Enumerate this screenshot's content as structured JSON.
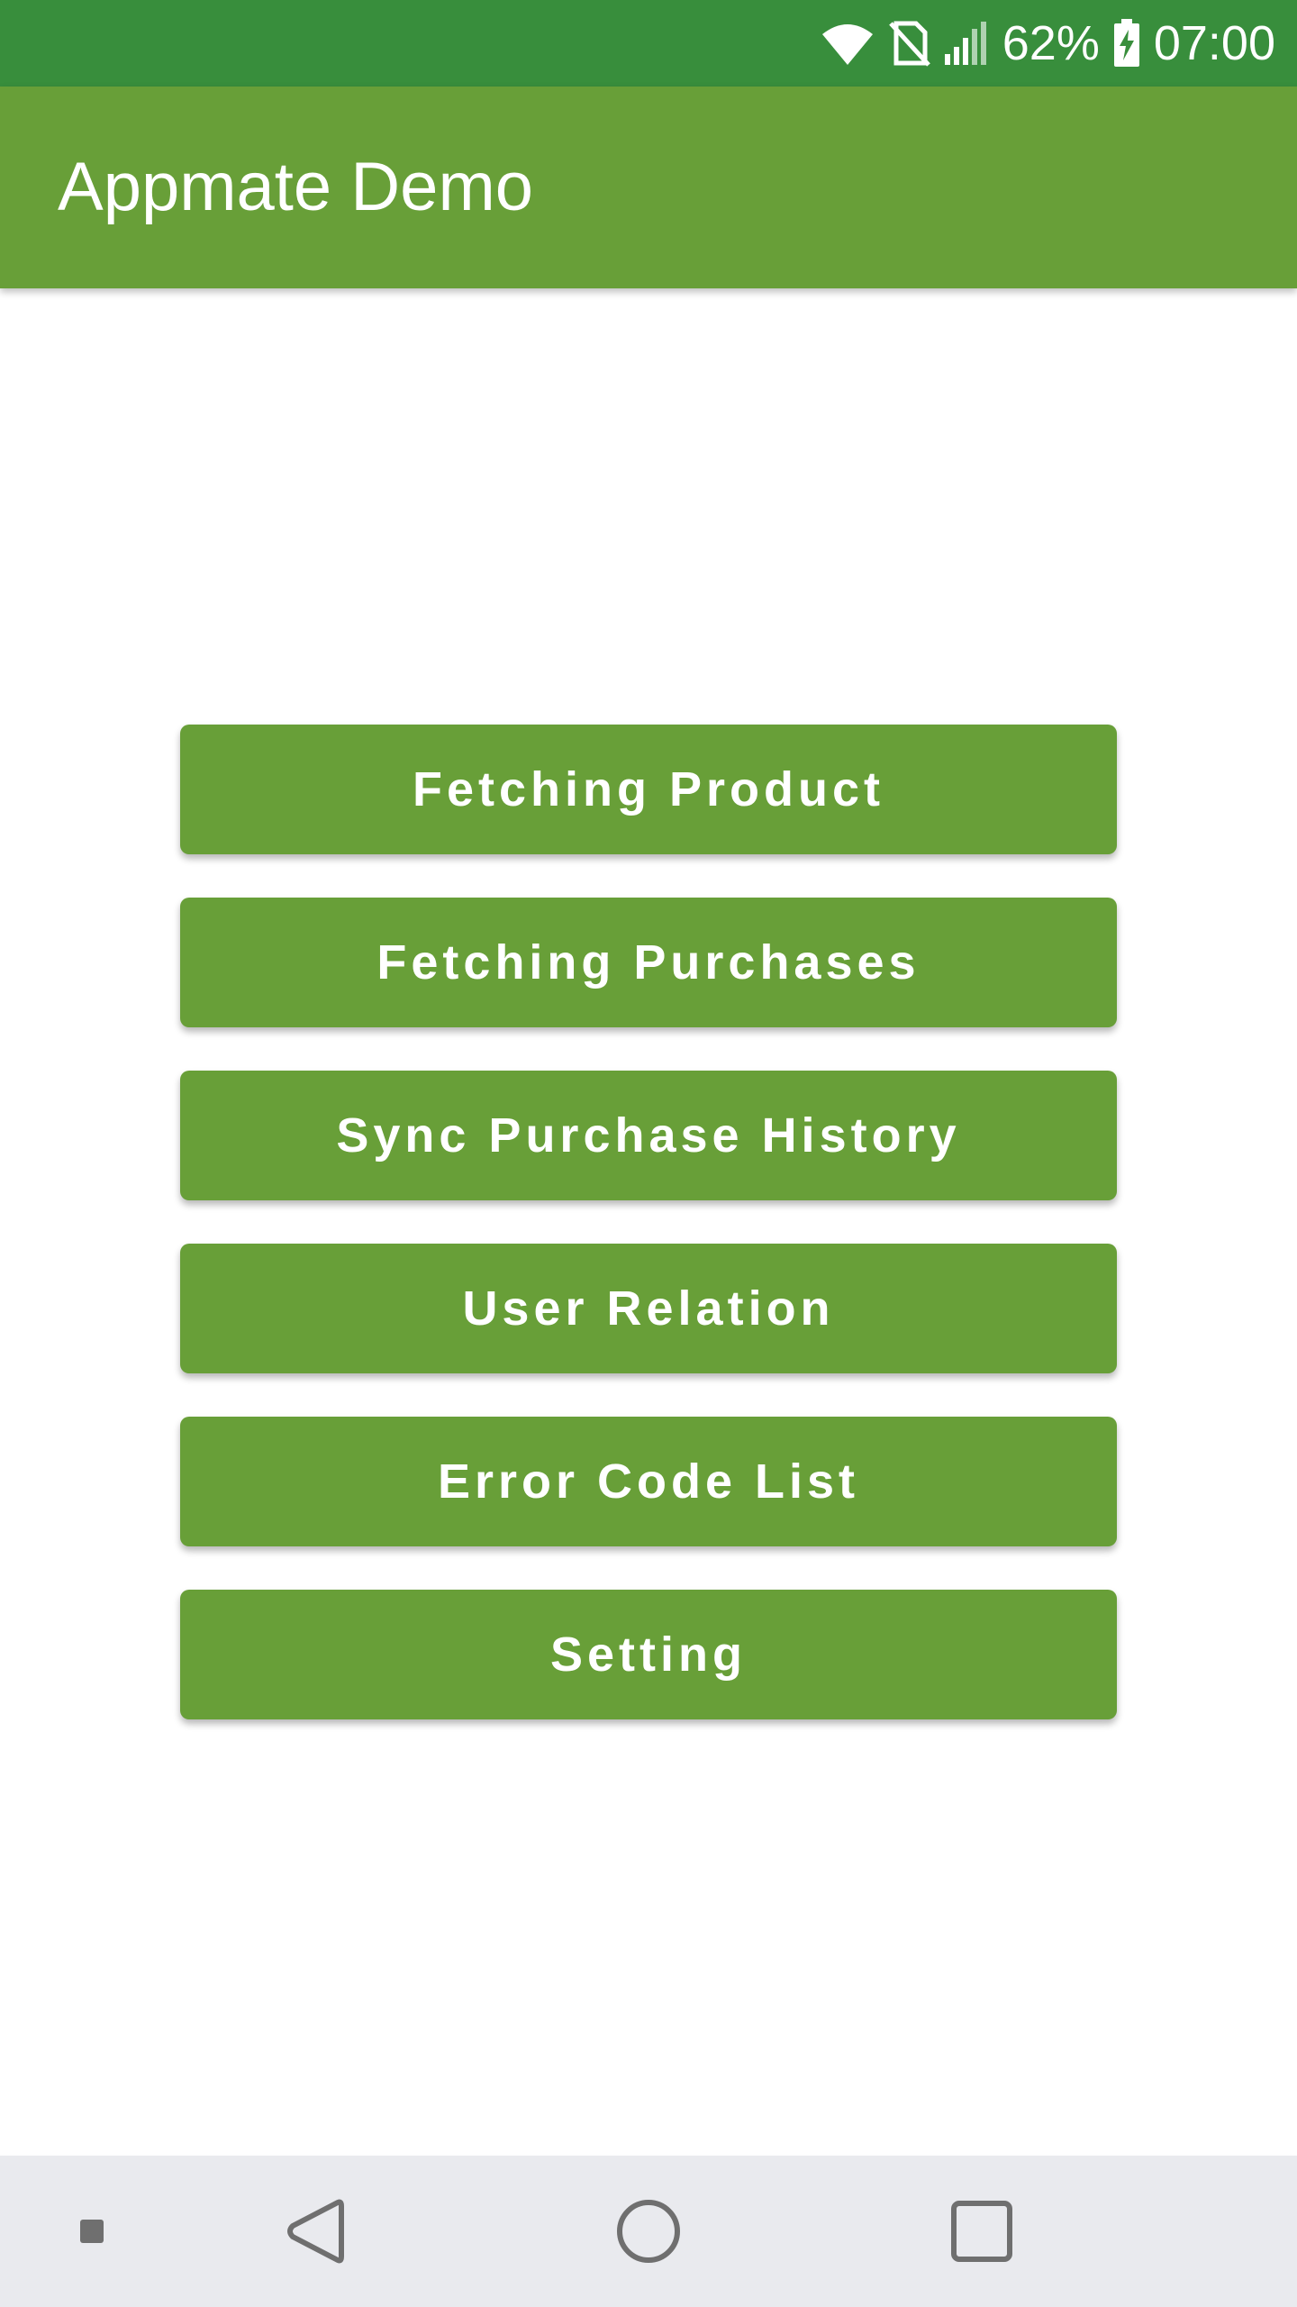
{
  "status_bar": {
    "battery_percent": "62%",
    "time": "07:00",
    "icons": [
      "wifi-icon",
      "no-sim-icon",
      "signal-icon",
      "battery-charging-icon"
    ],
    "background_color": "#388e3c"
  },
  "app_bar": {
    "title": "Appmate Demo",
    "background_color": "#689f38"
  },
  "buttons": [
    {
      "label": "Fetching Product"
    },
    {
      "label": "Fetching Purchases"
    },
    {
      "label": "Sync Purchase History"
    },
    {
      "label": "User Relation"
    },
    {
      "label": "Error Code List"
    },
    {
      "label": "Setting"
    }
  ],
  "nav_bar": {
    "icons": [
      "menu-dot-icon",
      "back-icon",
      "home-icon",
      "recents-icon"
    ],
    "background_color": "#e9eaee"
  }
}
